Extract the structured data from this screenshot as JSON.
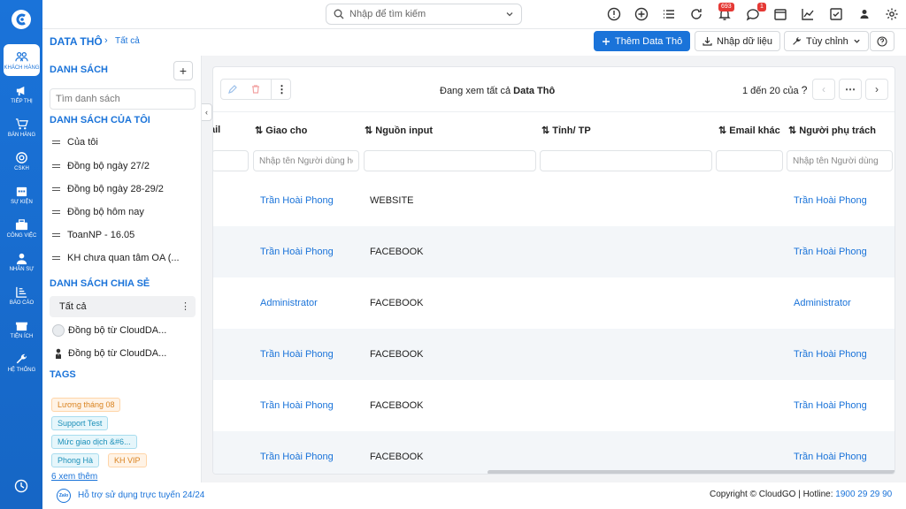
{
  "rail": {
    "items": [
      {
        "label": "KHÁCH HÀNG",
        "icon": "users-icon"
      },
      {
        "label": "TIẾP THỊ",
        "icon": "megaphone-icon"
      },
      {
        "label": "BÁN HÀNG",
        "icon": "cart-icon"
      },
      {
        "label": "CSKH",
        "icon": "lifebuoy-icon"
      },
      {
        "label": "SỰ KIỆN",
        "icon": "calendar-icon"
      },
      {
        "label": "CÔNG VIỆC",
        "icon": "briefcase-icon"
      },
      {
        "label": "NHÂN SỰ",
        "icon": "person-icon"
      },
      {
        "label": "BÁO CÁO",
        "icon": "report-icon"
      },
      {
        "label": "TIỆN ÍCH",
        "icon": "gift-icon"
      },
      {
        "label": "HỆ THỐNG",
        "icon": "wrench-icon"
      }
    ],
    "accent": "#1a73d9"
  },
  "topbar": {
    "search_placeholder": "Nhập để tìm kiếm",
    "notif_count": "693",
    "chat_count": "1"
  },
  "subheader": {
    "breadcrumb_main": "DATA THÔ",
    "breadcrumb_sep": "›",
    "breadcrumb_sub": "Tất cả",
    "add_label": "Thêm Data Thô",
    "import_label": "Nhập dữ liệu",
    "custom_label": "Tùy chỉnh"
  },
  "sidebar": {
    "title": "DANH SÁCH",
    "add": "+",
    "search_placeholder": "Tìm danh sách",
    "my_lists_title": "DANH SÁCH CỦA TÔI",
    "my_lists": [
      "Của tôi",
      "Đồng bộ ngày 27/2",
      "Đồng bộ ngày 28-29/2",
      "Đồng bộ hôm nay",
      "ToanNP - 16.05",
      "KH chưa quan tâm OA (..."
    ],
    "shared_title": "DANH SÁCH CHIA SẺ",
    "shared": [
      "Tất cả",
      "Đồng bộ từ CloudDA...",
      "Đồng bộ từ CloudDA..."
    ],
    "kebab": "⋮",
    "tags_title": "TAGS",
    "tags": [
      "Lương tháng 08",
      "Support Test",
      "Mức giao dịch &#6...",
      "Phong Hà",
      "KH VIP"
    ],
    "see_more": "6 xem thêm"
  },
  "main": {
    "viewing_prefix": "Đang xem tất cả",
    "viewing_entity": "Data Thô",
    "pager": "1 đến 20 của",
    "pager_q": "?",
    "columns": [
      {
        "key": "email",
        "label": "ail"
      },
      {
        "key": "assignee",
        "label": "Giao cho"
      },
      {
        "key": "source",
        "label": "Nguồn input"
      },
      {
        "key": "province",
        "label": "Tỉnh/ TP"
      },
      {
        "key": "email2",
        "label": "Email khác"
      },
      {
        "key": "owner",
        "label": "Người phụ trách"
      }
    ],
    "filter_user_placeholder": "Nhập tên Người dùng hoặc",
    "filter_owner_placeholder": "Nhập tên Người dùng",
    "rows": [
      {
        "assignee": "Trần Hoài Phong",
        "source": "WEBSITE",
        "owner": "Trần Hoài Phong"
      },
      {
        "assignee": "Trần Hoài Phong",
        "source": "FACEBOOK",
        "owner": "Trần Hoài Phong"
      },
      {
        "assignee": "Administrator",
        "source": "FACEBOOK",
        "owner": "Administrator"
      },
      {
        "assignee": "Trần Hoài Phong",
        "source": "FACEBOOK",
        "owner": "Trần Hoài Phong"
      },
      {
        "assignee": "Trần Hoài Phong",
        "source": "FACEBOOK",
        "owner": "Trần Hoài Phong"
      },
      {
        "assignee": "Trần Hoài Phong",
        "source": "FACEBOOK",
        "owner": "Trần Hoài Phong"
      }
    ]
  },
  "footer": {
    "zalo": "Zalo",
    "support": "Hỗ trợ sử dụng trực tuyến 24/24",
    "copyright": "Copyright © CloudGO",
    "hotline_label": "| Hotline:",
    "hotline": "1900 29 29 90"
  }
}
